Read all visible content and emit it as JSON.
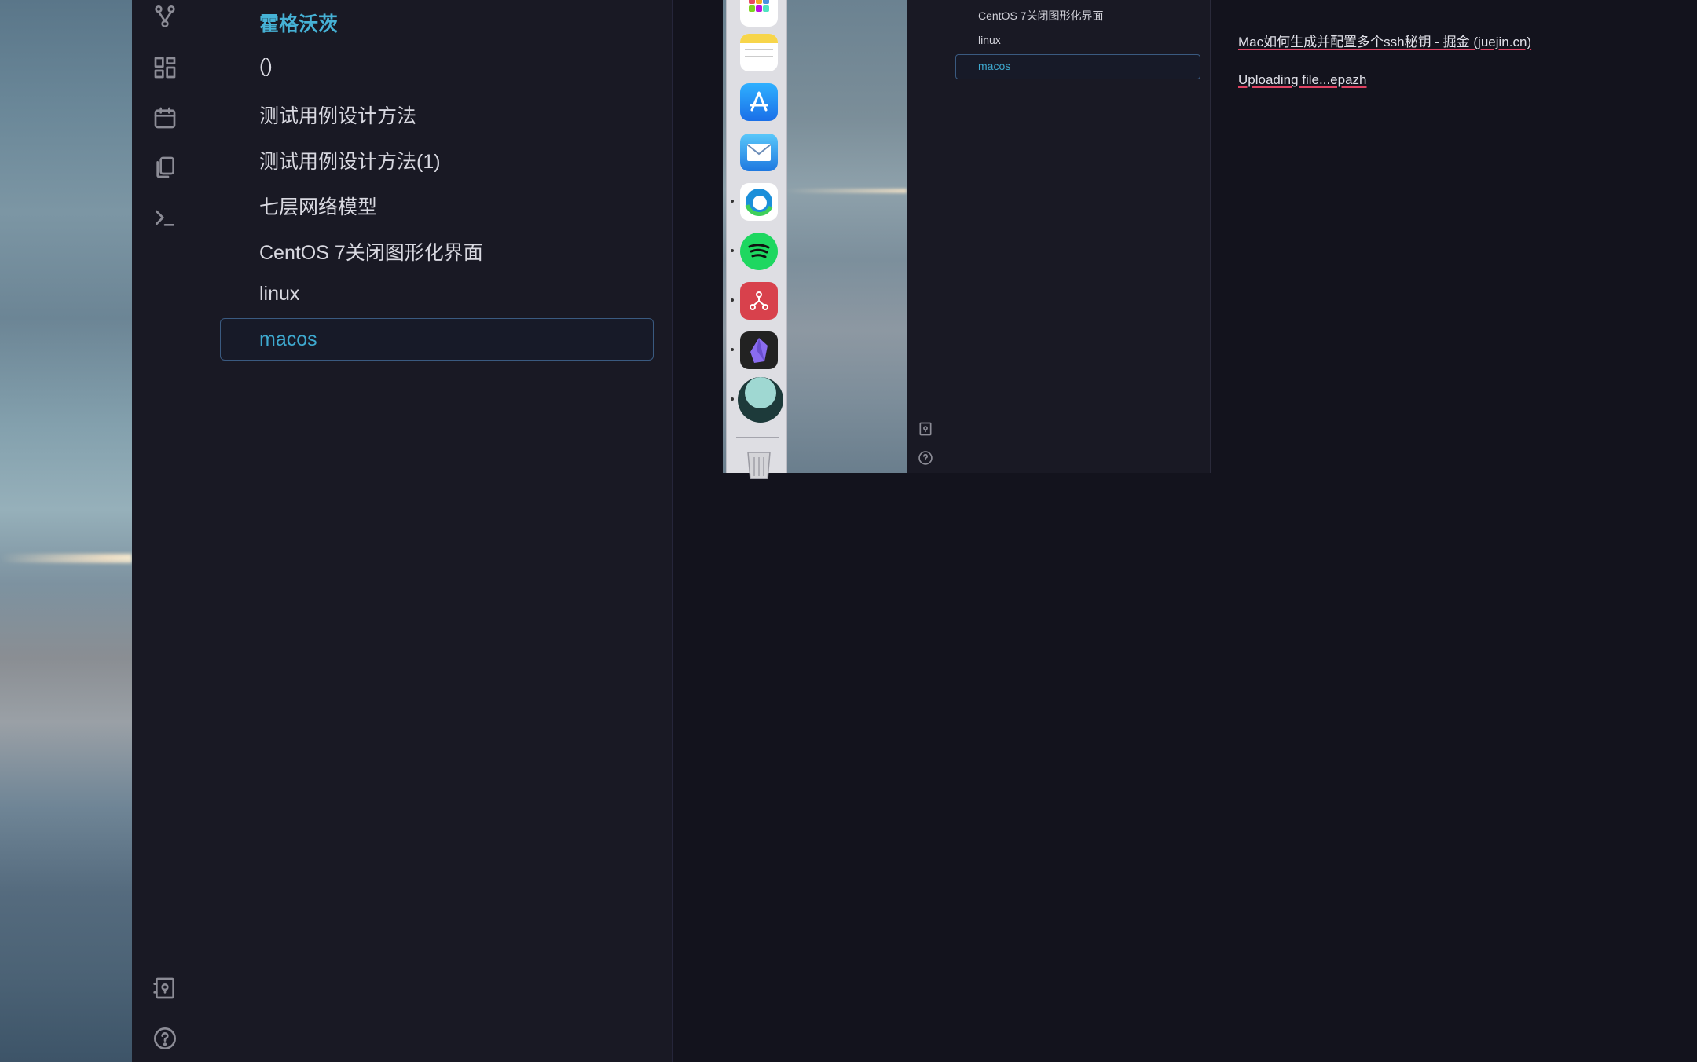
{
  "file_list": {
    "items": [
      {
        "label": "霍格沃茨",
        "kind": "folder"
      },
      {
        "label": "()",
        "kind": "file"
      },
      {
        "label": "测试用例设计方法",
        "kind": "file"
      },
      {
        "label": "测试用例设计方法(1)",
        "kind": "file"
      },
      {
        "label": "七层网络模型",
        "kind": "file"
      },
      {
        "label": "CentOS 7关闭图形化界面",
        "kind": "file"
      },
      {
        "label": "linux",
        "kind": "file"
      },
      {
        "label": "macos",
        "kind": "file",
        "active": true
      }
    ]
  },
  "ribbon": {
    "icons": [
      "graph-icon",
      "grid-icon",
      "calendar-icon",
      "copy-icon",
      "terminal-icon",
      "vault-icon",
      "help-icon"
    ]
  },
  "dock": {
    "apps": [
      "launchpad-icon",
      "notes-icon",
      "app-store-icon",
      "mail-icon",
      "edge-icon",
      "spotify-icon",
      "git-client-icon",
      "obsidian-icon",
      "moon-app-icon",
      "trash-icon"
    ]
  },
  "mini_file_list": {
    "items": [
      {
        "label": "CentOS 7关闭图形化界面"
      },
      {
        "label": "linux"
      },
      {
        "label": "macos",
        "active": true
      }
    ]
  },
  "editor": {
    "links": [
      "Mac如何生成并配置多个ssh秘钥 - 掘金 (juejin.cn)",
      "Uploading file...epazh"
    ]
  },
  "colors": {
    "background": "#13131d",
    "panel": "#191924",
    "accent": "#3ea9cf",
    "folder": "#46b2d6",
    "link_underline": "#e04363"
  }
}
